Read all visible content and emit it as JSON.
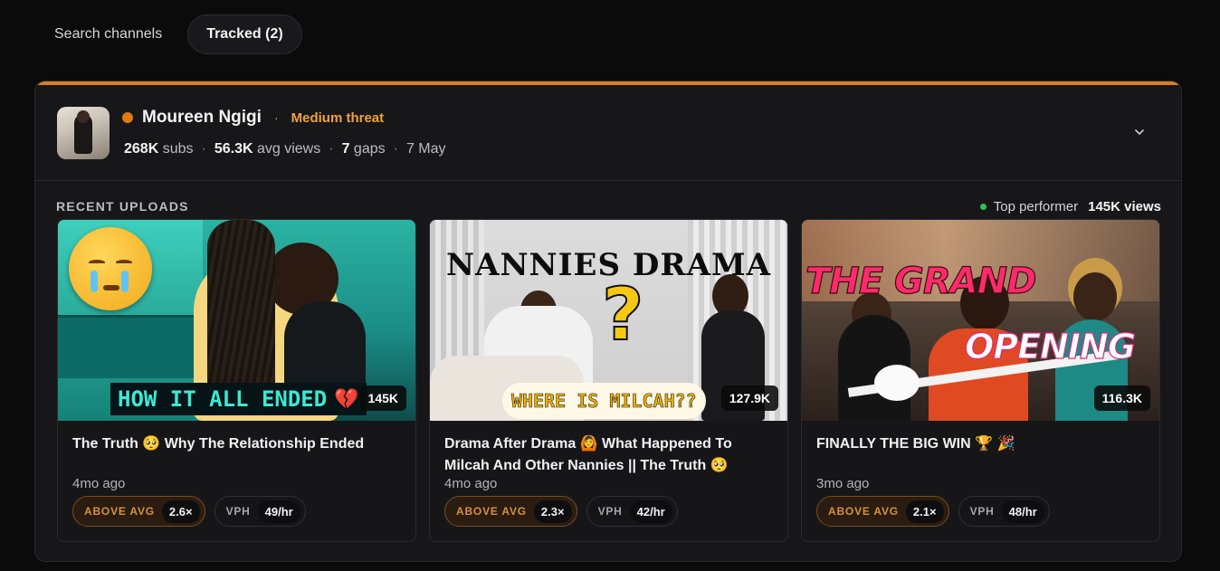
{
  "tabs": [
    {
      "label": "Search channels",
      "active": false
    },
    {
      "label": "Tracked (2)",
      "active": true
    }
  ],
  "channel": {
    "name": "Moureen Ngigi",
    "threat": "Medium threat",
    "threat_prefix": "·",
    "status_color": "#e07b13",
    "accent_color": "#d9801f",
    "subs_value": "268K",
    "subs_label": "subs",
    "avg_views_value": "56.3K",
    "avg_views_label": "avg views",
    "gaps_value": "7",
    "gaps_label": "gaps",
    "date": "7 May",
    "separator": "·"
  },
  "recent_uploads": {
    "label": "RECENT UPLOADS",
    "top_performer_label": "Top performer",
    "top_performer_value": "145K views"
  },
  "videos": [
    {
      "views": "145K",
      "title": "The Truth 🥺 Why The Relationship Ended",
      "age": "4mo ago",
      "avg_label": "ABOVE AVG",
      "avg_value": "2.6×",
      "vph_label": "VPH",
      "vph_value": "49/hr",
      "thumb_caption": "HOW IT ALL ENDED"
    },
    {
      "views": "127.9K",
      "title": "Drama After Drama 🙆 What Happened To Milcah And Other Nannies || The Truth 🥺",
      "age": "4mo ago",
      "avg_label": "ABOVE AVG",
      "avg_value": "2.3×",
      "vph_label": "VPH",
      "vph_value": "42/hr",
      "thumb_headline": "NANNIES DRAMA",
      "thumb_caption": "WHERE IS MILCAH??"
    },
    {
      "views": "116.3K",
      "title": "FINALLY THE BIG WIN 🏆 🎉",
      "age": "3mo ago",
      "avg_label": "ABOVE AVG",
      "avg_value": "2.1×",
      "vph_label": "VPH",
      "vph_value": "48/hr",
      "thumb_title_1": "THE GRAND",
      "thumb_title_2": "OPENING"
    }
  ]
}
